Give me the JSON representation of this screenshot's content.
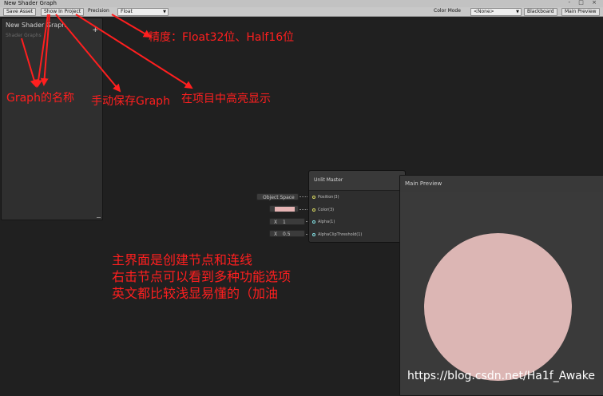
{
  "window": {
    "title": "New Shader Graph",
    "controls": "- □ ×"
  },
  "toolbar": {
    "save_asset": "Save Asset",
    "show_in_project": "Show In Project",
    "precision_label": "Precision",
    "precision_value": "Float",
    "color_mode_label": "Color Mode",
    "color_mode_value": "<None>",
    "blackboard": "Blackboard",
    "main_preview": "Main Preview"
  },
  "blackboard": {
    "title": "New Shader Graph",
    "subtitle": "Shader Graphs",
    "add": "+"
  },
  "node": {
    "title": "Unlit Master",
    "ports": [
      "Position(3)",
      "Color(3)",
      "Alpha(1)",
      "AlphaClipThreshold(1)"
    ],
    "inputs": {
      "position_space": "Object Space",
      "color_swatch": "#e6b4b4",
      "alpha_label": "X",
      "alpha_value": "1",
      "clip_label": "X",
      "clip_value": "0.5"
    }
  },
  "preview": {
    "title": "Main Preview",
    "sphere_color": "#dcb6b4"
  },
  "annotations": {
    "precision": "精度：Float32位、Half16位",
    "graph_name": "Graph的名称",
    "save": "手动保存Graph",
    "highlight": "在项目中高亮显示",
    "main_lines": [
      "主界面是创建节点和连线",
      "右击节点可以看到多种功能选项",
      "英文都比较浅显易懂的（加油"
    ],
    "color": "#ff1f1f"
  },
  "watermark": "https://blog.csdn.net/Ha1f_Awake"
}
